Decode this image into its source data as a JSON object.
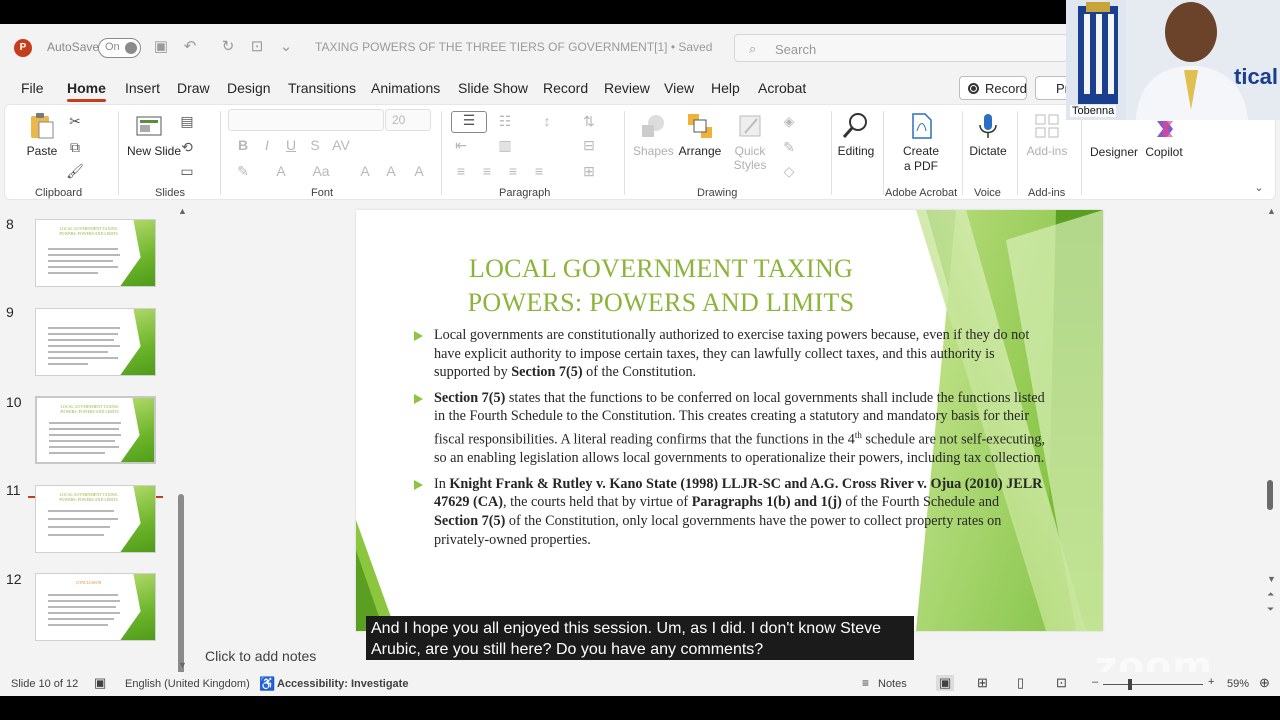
{
  "titlebar": {
    "autosave_label": "AutoSave",
    "autosave_state": "On",
    "document_title": "TAXING POWERS OF THE THREE TIERS OF GOVERNMENT[1] • Saved",
    "search_placeholder": "Search"
  },
  "menu": {
    "tabs": [
      "File",
      "Home",
      "Insert",
      "Draw",
      "Design",
      "Transitions",
      "Animations",
      "Slide Show",
      "Record",
      "Review",
      "View",
      "Help",
      "Acrobat"
    ],
    "active_tab": "Home",
    "record_button": "Record",
    "present_button": "Pr"
  },
  "ribbon": {
    "clipboard": {
      "paste": "Paste",
      "group": "Clipboard"
    },
    "slides": {
      "new_slide": "New Slide",
      "group": "Slides"
    },
    "font": {
      "size": "20",
      "group": "Font"
    },
    "paragraph": {
      "group": "Paragraph"
    },
    "drawing": {
      "shapes": "Shapes",
      "arrange": "Arrange",
      "quick_styles": "Quick Styles",
      "group": "Drawing"
    },
    "editing": {
      "label": "Editing"
    },
    "adobe": {
      "create_pdf": "Create a PDF",
      "group": "Adobe Acrobat"
    },
    "voice": {
      "dictate": "Dictate",
      "group": "Voice"
    },
    "addins": {
      "addins": "Add-ins",
      "group": "Add-ins"
    },
    "designer": "Designer",
    "copilot": "Copilot"
  },
  "thumbnails": [
    {
      "number": "8",
      "title": "LOCAL GOVERNMENT TAXING POWERS: POWERS AND LIMITS"
    },
    {
      "number": "9",
      "title": ""
    },
    {
      "number": "10",
      "title": "LOCAL GOVERNMENT TAXING POWERS: POWERS AND LIMITS"
    },
    {
      "number": "11",
      "title": "LOCAL GOVERNMENT TAXING POWERS: POWERS AND LIMITS"
    },
    {
      "number": "12",
      "title": "CONCLUSION"
    }
  ],
  "slide": {
    "title_line1": "LOCAL GOVERNMENT TAXING",
    "title_line2": "POWERS: POWERS AND LIMITS",
    "b1_text": "Local governments are constitutionally authorized to exercise taxing powers because, even if they do not have explicit authority to impose certain taxes, they can lawfully collect taxes, and this authority is supported by ",
    "b1_bold": "Section 7(5)",
    "b1_end": " of the Constitution.",
    "b2_bold": "Section 7(5)",
    "b2_text": " states that the functions to be conferred on local governments shall include the functions listed in the Fourth Schedule to the Constitution. This creates creating a statutory and mandatory basis for their fiscal responsibilities. A literal reading confirms that the functions in the 4",
    "b2_sup": "th",
    "b2_end": " schedule are not self-executing, so an enabling legislation allows local governments to operationalize their powers, including tax collection.",
    "b3_start": "In ",
    "b3_bold1": "Knight Frank & Rutley v. Kano State (1998) LLJR-SC and A.G. Cross River v. Ojua (2010) JELR 47629 (CA)",
    "b3_text1": ", the courts held that by virtue of ",
    "b3_bold2": "Paragraphs 1(b) and 1(j)",
    "b3_text2": " of the Fourth Schedule and ",
    "b3_bold3": "Section 7(5)",
    "b3_end": " of the Constitution, only local governments have the power to collect property rates on privately-owned properties."
  },
  "notes_placeholder": "Click to add notes",
  "caption": "And I hope you all enjoyed this session. Um, as I did. I don't know Steve Arubic, are you still here? Do you have any comments?",
  "zoom_watermark": "zoom",
  "webcam": {
    "name": "Tobenna",
    "banner_text": "tical"
  },
  "status": {
    "slide_position": "Slide 10 of 12",
    "language": "English (United Kingdom)",
    "accessibility": "Accessibility: Investigate",
    "notes": "Notes",
    "zoom_level": "59%"
  },
  "colors": {
    "accent": "#c43e1c",
    "slide_green": "#8cc63f",
    "title_green": "#8cb43a"
  }
}
